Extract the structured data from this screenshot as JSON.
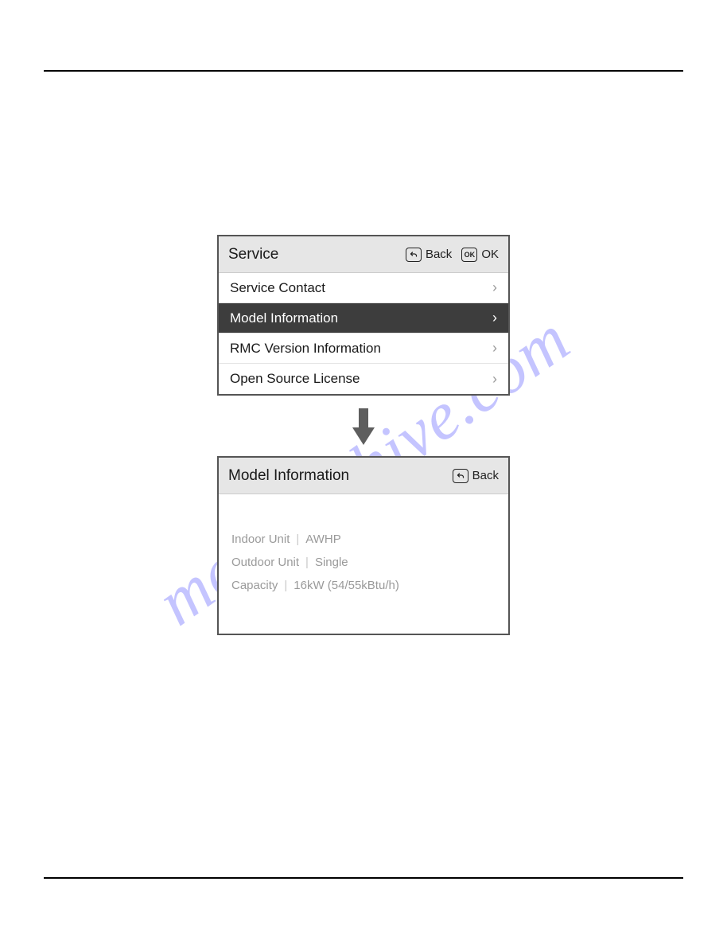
{
  "watermark": "manualshive.com",
  "service_panel": {
    "title": "Service",
    "back_label": "Back",
    "ok_label": "OK",
    "items": [
      {
        "label": "Service Contact",
        "selected": false
      },
      {
        "label": "Model Information",
        "selected": true
      },
      {
        "label": "RMC Version Information",
        "selected": false
      },
      {
        "label": "Open Source License",
        "selected": false
      }
    ]
  },
  "detail_panel": {
    "title": "Model Information",
    "back_label": "Back",
    "rows": [
      {
        "key": "Indoor Unit",
        "value": "AWHP"
      },
      {
        "key": "Outdoor Unit",
        "value": "Single"
      },
      {
        "key": "Capacity",
        "value": "16kW (54/55kBtu/h)"
      }
    ]
  }
}
